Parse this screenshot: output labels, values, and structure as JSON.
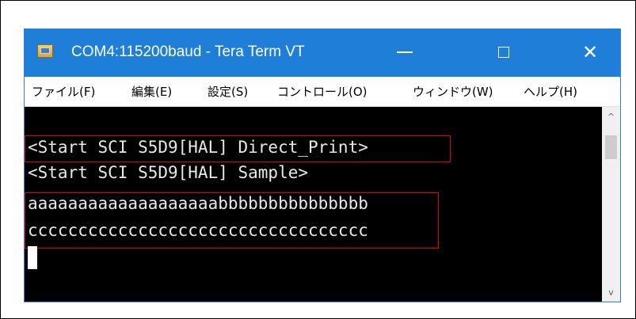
{
  "window": {
    "title": "COM4:115200baud - Tera Term VT"
  },
  "icons": {
    "app": "tera-term-app-icon",
    "minimize": "minimize-icon",
    "maximize": "maximize-icon",
    "close": "close-icon",
    "scroll_up": "chevron-up-icon",
    "scroll_down": "chevron-down-icon"
  },
  "titlebar_buttons": {
    "close_glyph": "✕"
  },
  "menu": {
    "items": [
      {
        "label": "ファイル(F)"
      },
      {
        "label": "編集(E)"
      },
      {
        "label": "設定(S)"
      },
      {
        "label": "コントロール(O)"
      },
      {
        "label": "ウィンドウ(W)"
      },
      {
        "label": "ヘルプ(H)"
      }
    ]
  },
  "terminal": {
    "lines": [
      "<Start SCI S5D9[HAL] Direct_Print>",
      "<Start SCI S5D9[HAL] Sample>",
      "aaaaaaaaaaaaaaaaaaabbbbbbbbbbbbbbb",
      "cccccccccccccccccccccccccccccccccc"
    ]
  },
  "scroll": {
    "up_glyph": "^",
    "down_glyph": "v"
  },
  "colors": {
    "titlebar": "#1f7ed8",
    "terminal_bg": "#000000",
    "terminal_fg": "#e8e8e8",
    "highlight": "#e10000"
  }
}
